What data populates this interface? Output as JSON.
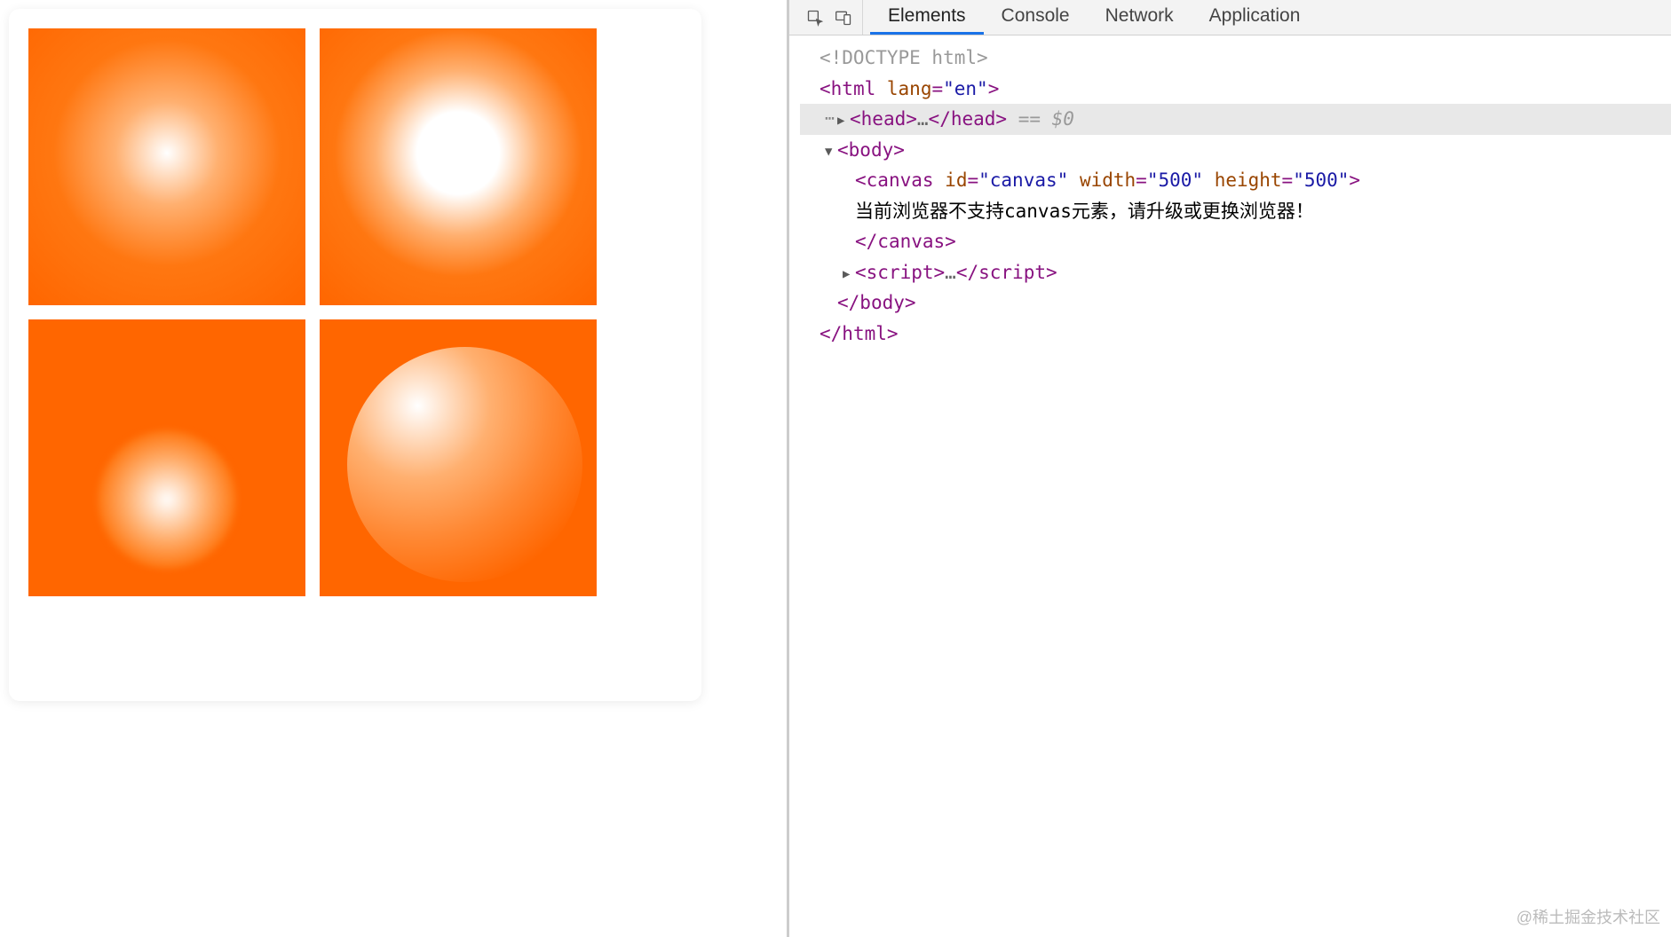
{
  "devtools": {
    "tabs": {
      "elements": "Elements",
      "console": "Console",
      "network": "Network",
      "application": "Application"
    },
    "selection_meta": "== $0"
  },
  "dom": {
    "doctype": "<!DOCTYPE html>",
    "html_open": "html",
    "html_lang_attr": "lang",
    "html_lang_val": "\"en\"",
    "head_tag": "head",
    "body_tag": "body",
    "canvas_tag": "canvas",
    "canvas_id_attr": "id",
    "canvas_id_val": "\"canvas\"",
    "canvas_width_attr": "width",
    "canvas_width_val": "\"500\"",
    "canvas_height_attr": "height",
    "canvas_height_val": "\"500\"",
    "canvas_fallback_text": "当前浏览器不支持canvas元素，请升级或更换浏览器！",
    "canvas_close": "canvas",
    "script_tag": "script",
    "body_close": "body",
    "html_close": "html",
    "ellipsis": "…"
  },
  "watermark": "@稀土掘金技术社区",
  "colors": {
    "orange": "#ff6600",
    "white": "#ffffff",
    "devtools_blue": "#1a73e8",
    "tag_purple": "#881280",
    "attr_orange": "#994500",
    "attr_blue": "#1a1aa6"
  }
}
